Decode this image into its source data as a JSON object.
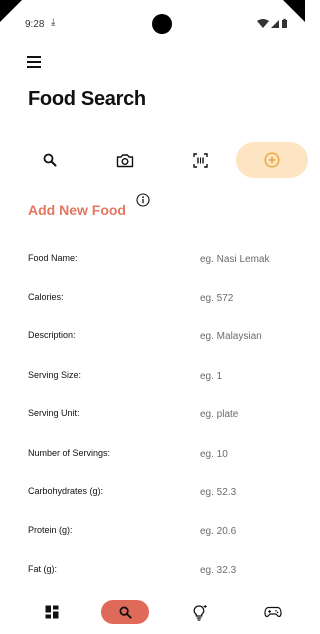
{
  "status_bar": {
    "time": "9:28",
    "download_glyph": "⤓",
    "icons": [
      "wifi-icon",
      "signal-icon",
      "battery-icon"
    ]
  },
  "header": {
    "menu_icon": "hamburger-menu-icon",
    "title": "Food Search"
  },
  "tabs": [
    {
      "name": "search",
      "icon": "search-icon",
      "active": false
    },
    {
      "name": "camera",
      "icon": "camera-icon",
      "active": false
    },
    {
      "name": "barcode",
      "icon": "barcode-scan-icon",
      "active": false
    },
    {
      "name": "add",
      "icon": "add-circle-icon",
      "active": true
    }
  ],
  "form": {
    "title": "Add New Food",
    "info_icon": "info-icon",
    "fields": [
      {
        "label": "Food Name:",
        "placeholder": "eg. Nasi Lemak"
      },
      {
        "label": "Calories:",
        "placeholder": "eg. 572"
      },
      {
        "label": "Description:",
        "placeholder": "eg. Malaysian"
      },
      {
        "label": "Serving Size:",
        "placeholder": "eg. 1"
      },
      {
        "label": "Serving Unit:",
        "placeholder": "eg. plate"
      },
      {
        "label": "Number of Servings:",
        "placeholder": "eg. 10"
      },
      {
        "label": "Carbohydrates (g):",
        "placeholder": "eg. 52.3"
      },
      {
        "label": "Protein (g):",
        "placeholder": "eg. 20.6"
      },
      {
        "label": "Fat (g):",
        "placeholder": "eg. 32.3"
      }
    ]
  },
  "bottom_nav": [
    {
      "name": "dashboard",
      "icon": "dashboard-icon",
      "active": false
    },
    {
      "name": "search",
      "icon": "search-icon",
      "active": true
    },
    {
      "name": "ideas",
      "icon": "lightbulb-icon",
      "active": false
    },
    {
      "name": "games",
      "icon": "gamepad-icon",
      "active": false
    }
  ],
  "colors": {
    "accent": "#e5765f",
    "nav_active_bg": "#e06a5a",
    "tab_active_bg": "#fde5c4",
    "tab_active_icon": "#e8a23a",
    "text": "#111111",
    "placeholder": "#6b6b6b"
  }
}
